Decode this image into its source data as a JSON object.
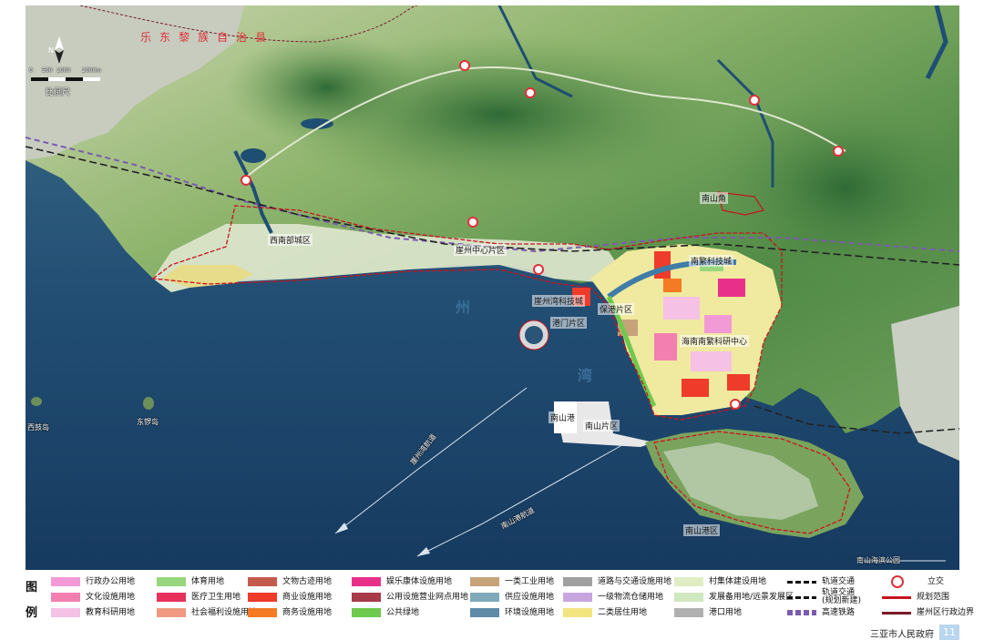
{
  "map": {
    "scale_label": "比例尺",
    "scale_ticks": [
      "0",
      "500",
      "1000",
      "2000m"
    ],
    "north_label": "N",
    "county_label": "乐东黎族自治县",
    "bay_chars": [
      "州",
      "湾"
    ],
    "district_labels": [
      "西南部城区",
      "崖州中心片区",
      "崖州湾科技城",
      "保港片区",
      "港门片区",
      "南山港",
      "南繁科技城",
      "南山片区",
      "海南南繁科研中心",
      "南山角",
      "南山港区"
    ],
    "island_labels": [
      "西鼓岛",
      "东锣岛"
    ],
    "shipping_lane_labels": [
      "崖州湾航道",
      "南山港航道"
    ],
    "coast_label": "南山海滨公园"
  },
  "legend": {
    "title_chars": [
      "图",
      "例"
    ],
    "items": [
      {
        "label": "行政办公用地",
        "color": "#f29ad6"
      },
      {
        "label": "文化设施用地",
        "color": "#f27fb0"
      },
      {
        "label": "教育科研用地",
        "color": "#f5c1e4"
      },
      {
        "label": "体育用地",
        "color": "#97d67d"
      },
      {
        "label": "医疗卫生用地",
        "color": "#e8315c"
      },
      {
        "label": "社会福利设施用地",
        "color": "#ee9a80"
      },
      {
        "label": "文物古迹用地",
        "color": "#c45a4c"
      },
      {
        "label": "商业设施用地",
        "color": "#ef3b2a"
      },
      {
        "label": "商务设施用地",
        "color": "#f57a24"
      },
      {
        "label": "娱乐康体设施用地",
        "color": "#e8308a"
      },
      {
        "label": "公用设施营业网点用地",
        "color": "#a83a4a"
      },
      {
        "label": "公共绿地",
        "color": "#6fc94e"
      },
      {
        "label": "一类工业用地",
        "color": "#c7a37a"
      },
      {
        "label": "供应设施用地",
        "color": "#7fa9b9"
      },
      {
        "label": "环境设施用地",
        "color": "#5f8ba6"
      },
      {
        "label": "道路与交通设施用地",
        "color": "#a0a0a0"
      },
      {
        "label": "一级物流仓储用地",
        "color": "#c7a6e0"
      },
      {
        "label": "二类居住用地",
        "color": "#f2e580"
      },
      {
        "label": "村集体建设用地",
        "color": "#e0edc4"
      },
      {
        "label": "发展备用地/远景发展区",
        "color": "#cfe8c0"
      },
      {
        "label": "港口用地",
        "color": "#b0b0b0"
      },
      {
        "label": "轨道交通",
        "color": "#111111"
      },
      {
        "label": "轨道交通\n(规划新建)",
        "color": "#111111"
      },
      {
        "label": "高速铁路",
        "color": "#7a5cae"
      },
      {
        "label": "立交",
        "color": "#e0303a"
      },
      {
        "label": "规划范围",
        "color": "#c8141e"
      },
      {
        "label": "崖州区行政边界",
        "color": "#7a1a2a"
      }
    ]
  },
  "footer": {
    "org": "三亚市人民政府",
    "page": "11"
  }
}
